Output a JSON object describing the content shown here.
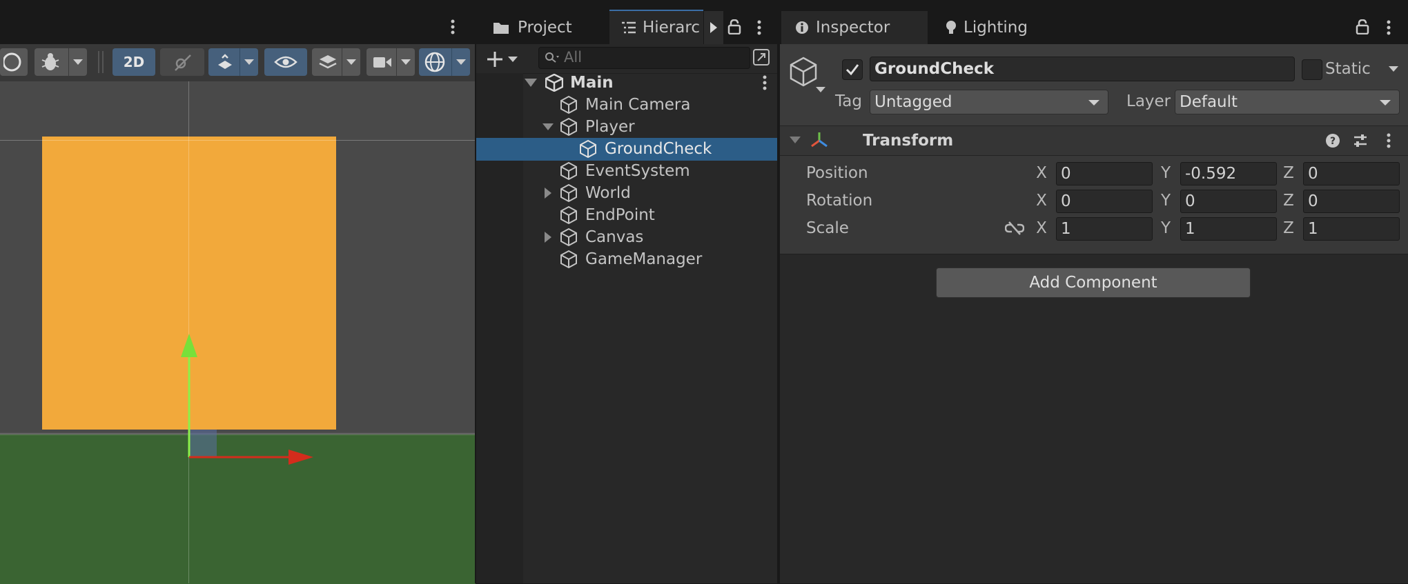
{
  "scene": {
    "toolbar": {
      "mode_2d_label": "2D"
    }
  },
  "tabs": {
    "project": "Project",
    "hierarchy": "Hierarc",
    "inspector": "Inspector",
    "lighting": "Lighting"
  },
  "hierarchy": {
    "search_placeholder": "All",
    "items": [
      {
        "label": "Main",
        "depth": 0,
        "expanded": true,
        "scene": true
      },
      {
        "label": "Main Camera",
        "depth": 1
      },
      {
        "label": "Player",
        "depth": 1,
        "expanded": true
      },
      {
        "label": "GroundCheck",
        "depth": 2,
        "selected": true
      },
      {
        "label": "EventSystem",
        "depth": 1
      },
      {
        "label": "World",
        "depth": 1,
        "collapsed": true
      },
      {
        "label": "EndPoint",
        "depth": 1
      },
      {
        "label": "Canvas",
        "depth": 1,
        "collapsed": true
      },
      {
        "label": "GameManager",
        "depth": 1
      }
    ]
  },
  "inspector": {
    "object_name": "GroundCheck",
    "active": true,
    "static_label": "Static",
    "tag_label": "Tag",
    "tag_value": "Untagged",
    "layer_label": "Layer",
    "layer_value": "Default",
    "component": {
      "name": "Transform",
      "rows": [
        {
          "label": "Position",
          "x": "0",
          "y": "-0.592",
          "z": "0"
        },
        {
          "label": "Rotation",
          "x": "0",
          "y": "0",
          "z": "0"
        },
        {
          "label": "Scale",
          "x": "1",
          "y": "1",
          "z": "1"
        }
      ],
      "axis_labels": [
        "X",
        "Y",
        "Z"
      ]
    },
    "add_component_label": "Add Component"
  },
  "colors": {
    "accent": "#2c5d87",
    "scene_object": "#f2a93b",
    "ground": "#3a6432"
  }
}
